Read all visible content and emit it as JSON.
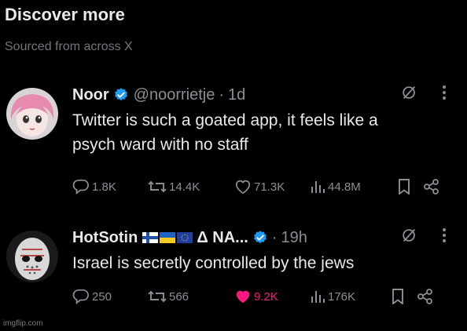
{
  "section": {
    "title": "Discover more",
    "subtitle": "Sourced from across X"
  },
  "tweets": [
    {
      "display_name": "Noor",
      "handle": "@noorrietje",
      "time": "1d",
      "text_line1": "Twitter is such a goated app, it feels like a",
      "text_line2": "psych ward with no staff",
      "replies": "1.8K",
      "reposts": "14.4K",
      "likes": "71.3K",
      "views": "44.8M",
      "liked": false,
      "verified": true
    },
    {
      "display_name": "HotSotin",
      "name_suffix": "Δ NA...",
      "time": "19h",
      "text_line1": "Israel is secretly controlled by the jews",
      "replies": "250",
      "reposts": "566",
      "likes": "9.2K",
      "views": "176K",
      "liked": true,
      "verified": true
    }
  ],
  "icons": {
    "reply": "reply-icon",
    "repost": "repost-icon",
    "like": "heart-icon",
    "views": "views-icon",
    "bookmark": "bookmark-icon",
    "share": "share-icon",
    "grok": "grok-icon",
    "more": "more-icon"
  },
  "colors": {
    "background": "#000000",
    "text": "#e7e9ea",
    "muted": "#8b8f94",
    "verified": "#1d9bf0",
    "like_active": "#f91880"
  },
  "watermark": "imgflip.com"
}
